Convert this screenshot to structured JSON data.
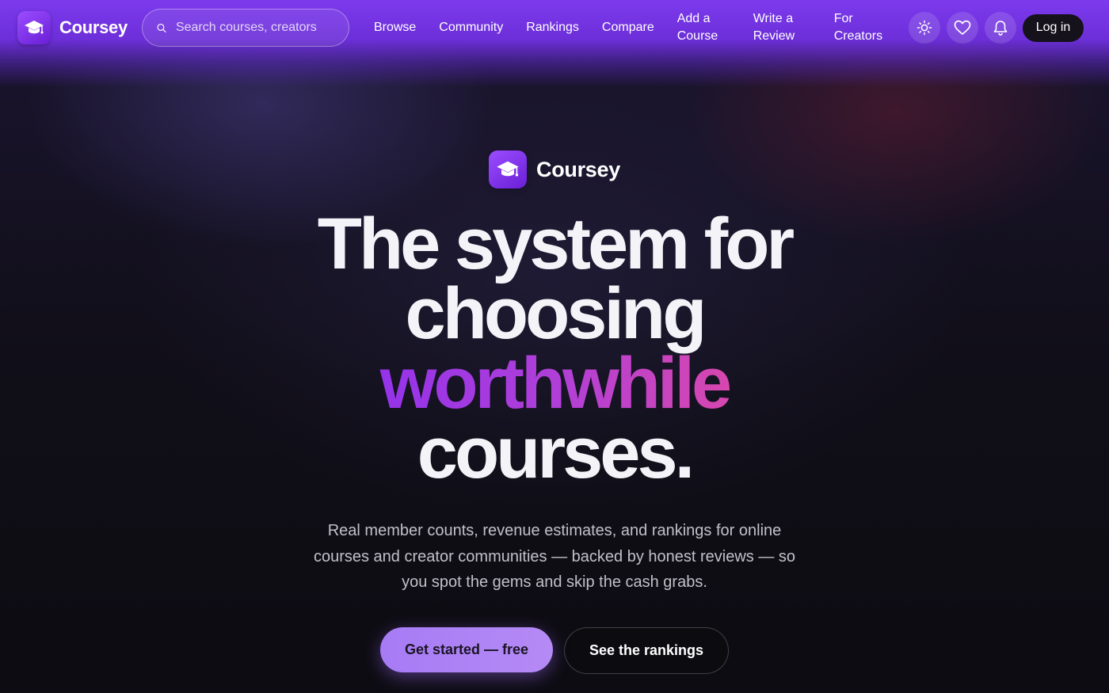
{
  "brand": {
    "name": "Coursey",
    "icon": "graduation-cap-icon"
  },
  "search": {
    "placeholder": "Search courses, creators"
  },
  "nav": {
    "browse": "Browse",
    "community": "Community",
    "rankings": "Rankings",
    "compare": "Compare",
    "add_course": "Add a Course",
    "write_review": "Write a Review",
    "for_creators": "For Creators",
    "icons": [
      "sun-icon",
      "heart-icon",
      "bell-icon"
    ],
    "login": "Log in"
  },
  "hero": {
    "brand_name": "Coursey",
    "headline_line1": "The system for",
    "headline_line2": "choosing",
    "headline_accent": "worthwhile",
    "headline_line4": "courses.",
    "subtitle": "Real member counts, revenue estimates, and rankings for online courses and creator communities — backed by honest reviews — so you spot the gems and skip the cash grabs.",
    "cta_primary": "Get started — free",
    "cta_secondary": "See the rankings"
  },
  "colors": {
    "accent": "#7c3aed",
    "accent_gradient_start": "#8b2ff0",
    "accent_gradient_end": "#e44aa0",
    "primary_button": "#a67bf5",
    "background": "#0f0d15"
  }
}
